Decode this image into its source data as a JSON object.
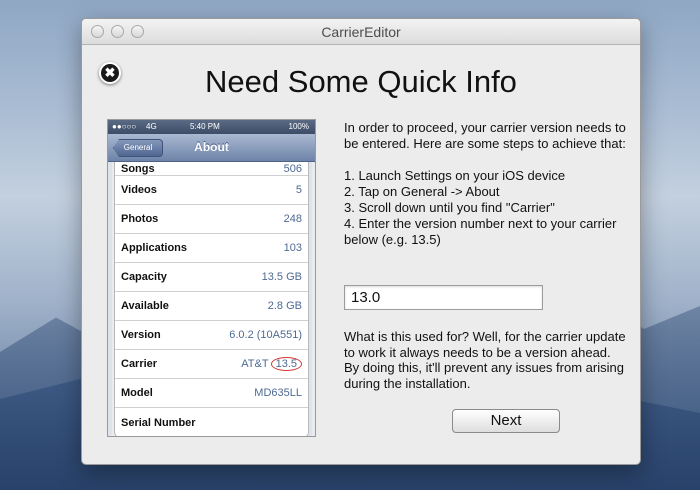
{
  "window": {
    "title": "CarrierEditor"
  },
  "heading": "Need Some Quick Info",
  "close_glyph": "✖",
  "phone": {
    "status": {
      "carrier_symbol": "●●○○○",
      "network": "4G",
      "time": "5:40 PM",
      "battery": "100%"
    },
    "back_label": "General",
    "nav_title": "About",
    "rows": [
      {
        "key": "Songs",
        "value": "506"
      },
      {
        "key": "Videos",
        "value": "5"
      },
      {
        "key": "Photos",
        "value": "248"
      },
      {
        "key": "Applications",
        "value": "103"
      },
      {
        "key": "Capacity",
        "value": "13.5 GB"
      },
      {
        "key": "Available",
        "value": "2.8 GB"
      },
      {
        "key": "Version",
        "value": "6.0.2 (10A551)"
      },
      {
        "key": "Carrier",
        "value_prefix": "AT&T",
        "value_highlight": "13.5"
      },
      {
        "key": "Model",
        "value": "MD635LL"
      },
      {
        "key": "Serial Number",
        "value": ""
      }
    ]
  },
  "instructions": "In order to proceed, your carrier version needs to be entered. Here are some steps to achieve that:\n\n1. Launch Settings on your iOS device\n2. Tap on General -> About\n3. Scroll down until you find \"Carrier\"\n4. Enter the version number next to your carrier below (e.g. 13.5)",
  "version_input": {
    "value": "13.0"
  },
  "explanation": "What is this used for? Well, for the carrier update to work it always needs to be a version ahead. By doing this, it'll prevent any issues from arising during the installation.",
  "next_label": "Next",
  "colors": {
    "link_blue": "#4e6a94",
    "highlight_red": "#d23a3a"
  }
}
